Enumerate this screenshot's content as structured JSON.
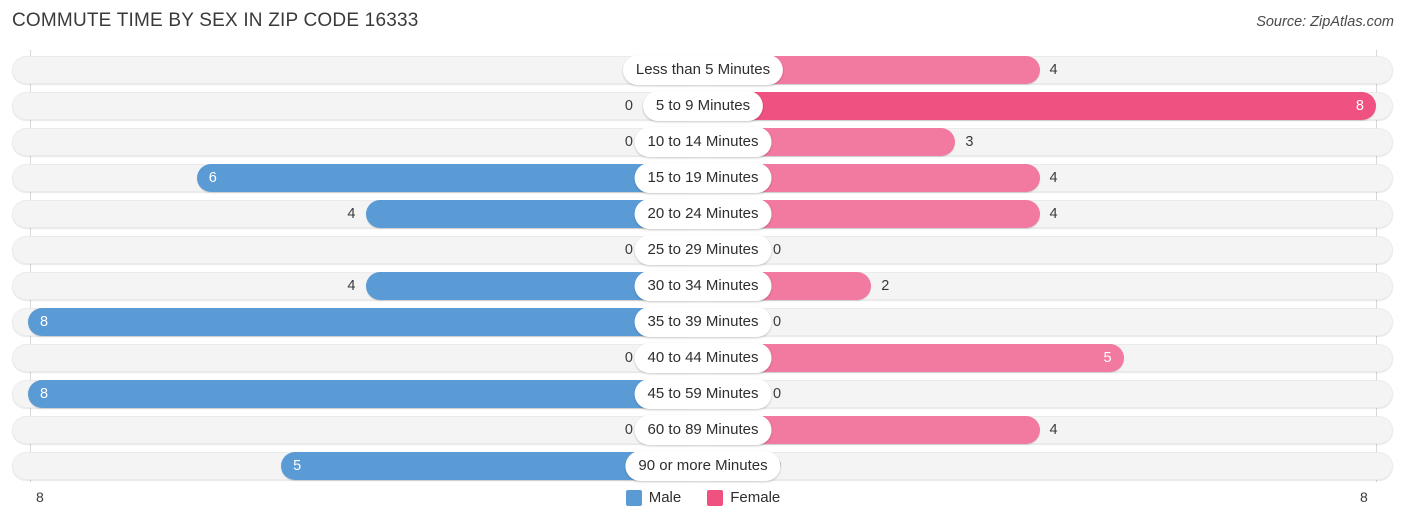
{
  "header": {
    "title": "COMMUTE TIME BY SEX IN ZIP CODE 16333",
    "source": "Source: ZipAtlas.com"
  },
  "legend": {
    "male_label": "Male",
    "female_label": "Female",
    "male_color": "#5b9bd5",
    "female_color": "#ef5181"
  },
  "axis": {
    "left_max": "8",
    "right_max": "8"
  },
  "chart_data": {
    "type": "bar",
    "title": "COMMUTE TIME BY SEX IN ZIP CODE 16333",
    "subtype": "diverging-horizontal-bar",
    "xlabel": "",
    "ylabel": "",
    "xlim": [
      8,
      8
    ],
    "grid": false,
    "legend_position": "bottom-center",
    "categories": [
      "Less than 5 Minutes",
      "5 to 9 Minutes",
      "10 to 14 Minutes",
      "15 to 19 Minutes",
      "20 to 24 Minutes",
      "25 to 29 Minutes",
      "30 to 34 Minutes",
      "35 to 39 Minutes",
      "40 to 44 Minutes",
      "45 to 59 Minutes",
      "60 to 89 Minutes",
      "90 or more Minutes"
    ],
    "series": [
      {
        "name": "Male",
        "direction": "left",
        "color": "#5b9bd5",
        "values": [
          0,
          0,
          0,
          6,
          4,
          0,
          4,
          8,
          0,
          8,
          0,
          5
        ]
      },
      {
        "name": "Female",
        "direction": "right",
        "color": "#ef5181",
        "values": [
          4,
          8,
          3,
          4,
          4,
          0,
          2,
          0,
          5,
          0,
          4,
          0
        ]
      }
    ]
  }
}
